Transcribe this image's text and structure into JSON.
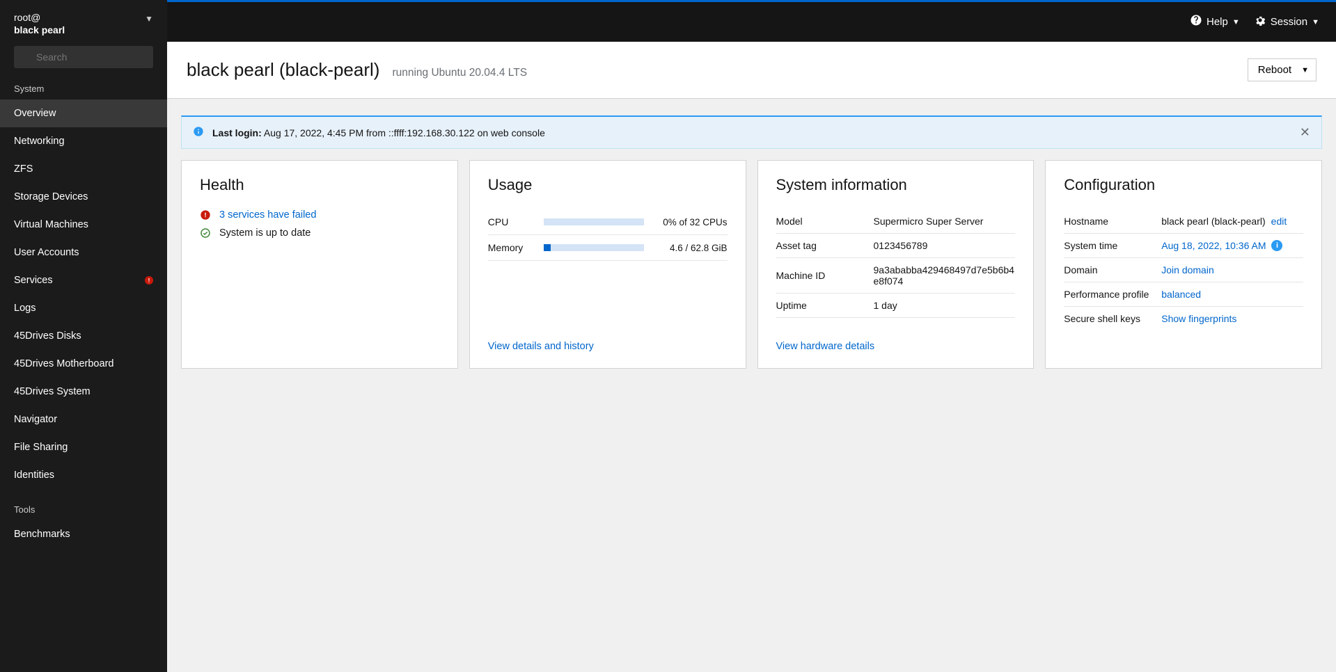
{
  "sidebar": {
    "user": "root@",
    "hostname": "black pearl",
    "search_placeholder": "Search",
    "section_system": "System",
    "section_tools": "Tools",
    "items": [
      {
        "label": "Overview",
        "active": true
      },
      {
        "label": "Networking"
      },
      {
        "label": "ZFS"
      },
      {
        "label": "Storage Devices"
      },
      {
        "label": "Virtual Machines"
      },
      {
        "label": "User Accounts"
      },
      {
        "label": "Services",
        "badge": true
      },
      {
        "label": "Logs"
      },
      {
        "label": "45Drives Disks"
      },
      {
        "label": "45Drives Motherboard"
      },
      {
        "label": "45Drives System"
      },
      {
        "label": "Navigator"
      },
      {
        "label": "File Sharing"
      },
      {
        "label": "Identities"
      }
    ],
    "tools": [
      {
        "label": "Benchmarks"
      }
    ]
  },
  "topbar": {
    "help": "Help",
    "session": "Session"
  },
  "header": {
    "title": "black pearl (black-pearl)",
    "subtitle": "running Ubuntu 20.04.4 LTS",
    "reboot": "Reboot"
  },
  "alert": {
    "label": "Last login:",
    "text": " Aug 17, 2022, 4:45 PM from ::ffff:192.168.30.122 on web console"
  },
  "health": {
    "title": "Health",
    "failed": "3 services have failed",
    "uptodate": "System is up to date"
  },
  "usage": {
    "title": "Usage",
    "cpu_label": "CPU",
    "cpu_val": "0% of 32 CPUs",
    "cpu_pct": 0,
    "mem_label": "Memory",
    "mem_val": "4.6 / 62.8 GiB",
    "mem_pct": 7,
    "details": "View details and history"
  },
  "sysinfo": {
    "title": "System information",
    "rows": [
      {
        "k": "Model",
        "v": "Supermicro Super Server"
      },
      {
        "k": "Asset tag",
        "v": "0123456789"
      },
      {
        "k": "Machine ID",
        "v": "9a3ababba429468497d7e5b6b4e8f074"
      },
      {
        "k": "Uptime",
        "v": "1 day"
      }
    ],
    "details": "View hardware details"
  },
  "config": {
    "title": "Configuration",
    "rows": [
      {
        "k": "Hostname",
        "v": "black pearl (black-pearl)",
        "edit": "edit"
      },
      {
        "k": "System time",
        "v": "Aug 18, 2022, 10:36 AM",
        "link": true,
        "info": true
      },
      {
        "k": "Domain",
        "v": "Join domain",
        "link": true
      },
      {
        "k": "Performance profile",
        "v": "balanced",
        "link": true
      },
      {
        "k": "Secure shell keys",
        "v": "Show fingerprints",
        "link": true
      }
    ]
  }
}
